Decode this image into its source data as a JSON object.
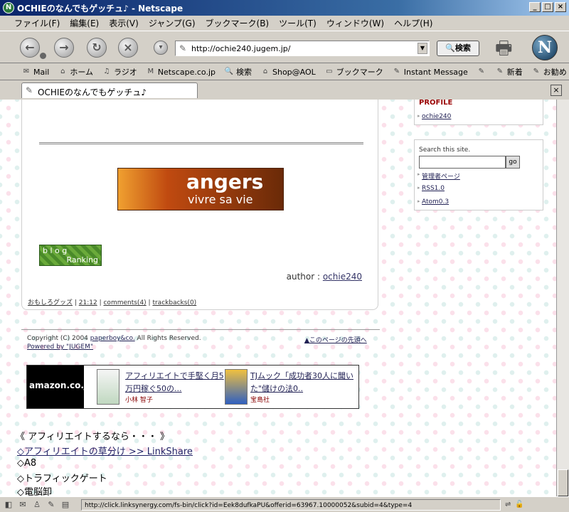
{
  "window": {
    "title": "OCHIEのなんでもゲッチュ♪ - Netscape"
  },
  "menu": [
    "ファイル(F)",
    "編集(E)",
    "表示(V)",
    "ジャンプ(G)",
    "ブックマーク(B)",
    "ツール(T)",
    "ウィンドウ(W)",
    "ヘルプ(H)"
  ],
  "nav": {
    "url": "http://ochie240.jugem.jp/",
    "search_label": "検索"
  },
  "bookmarks": [
    "Mail",
    "ホーム",
    "ラジオ",
    "Netscape.co.jp",
    "検索",
    "Shop@AOL",
    "ブックマーク",
    "Instant Message",
    "",
    "新着",
    "お勧め"
  ],
  "tab": {
    "title": "OCHIEのなんでもゲッチュ♪"
  },
  "post": {
    "banner_title": "angers",
    "banner_sub": "vivre sa vie",
    "blog_ranking": "b l o g",
    "blog_ranking2": "Ranking",
    "author_prefix": "author : ",
    "author": "ochie240",
    "category": "おもしろグッズ",
    "time": "21:12",
    "comments": "comments(4)",
    "trackbacks": "trackbacks(0)"
  },
  "sidebar": {
    "profile_heading": "PROFILE",
    "profile_link": "ochie240",
    "search_label": "Search this site.",
    "go": "go",
    "links": [
      "管理者ページ",
      "RSS1.0",
      "Atom0.3"
    ]
  },
  "footer": {
    "copyright": "Copyright (C) 2004 ",
    "company": "paperboy&co.",
    "rights": " All Rights Reserved.",
    "powered": "Powered by \"JUGEM\"",
    "pagetop": "▲このページの先頭へ"
  },
  "amazon": {
    "logo": "amazon.co.jp",
    "books": [
      {
        "title": "アフィリエイトで手堅く月5万円稼ぐ50の...",
        "author": "小林 智子"
      },
      {
        "title": "TJムック「成功者30人に聞いた\"儲けの法0..",
        "author": "宝島社"
      }
    ]
  },
  "affiliate": {
    "heading": "《 アフィリエイトするなら・・・ 》",
    "items": [
      "◇アフィリエイトの草分け >> LinkShare",
      "◇A8",
      "◇トラフィックゲート",
      "◇電脳卸"
    ]
  },
  "status": {
    "url": "http://click.linksynergy.com/fs-bin/click?id=Eek8dufkaPU&offerid=63967.10000052&subid=4&type=4"
  }
}
